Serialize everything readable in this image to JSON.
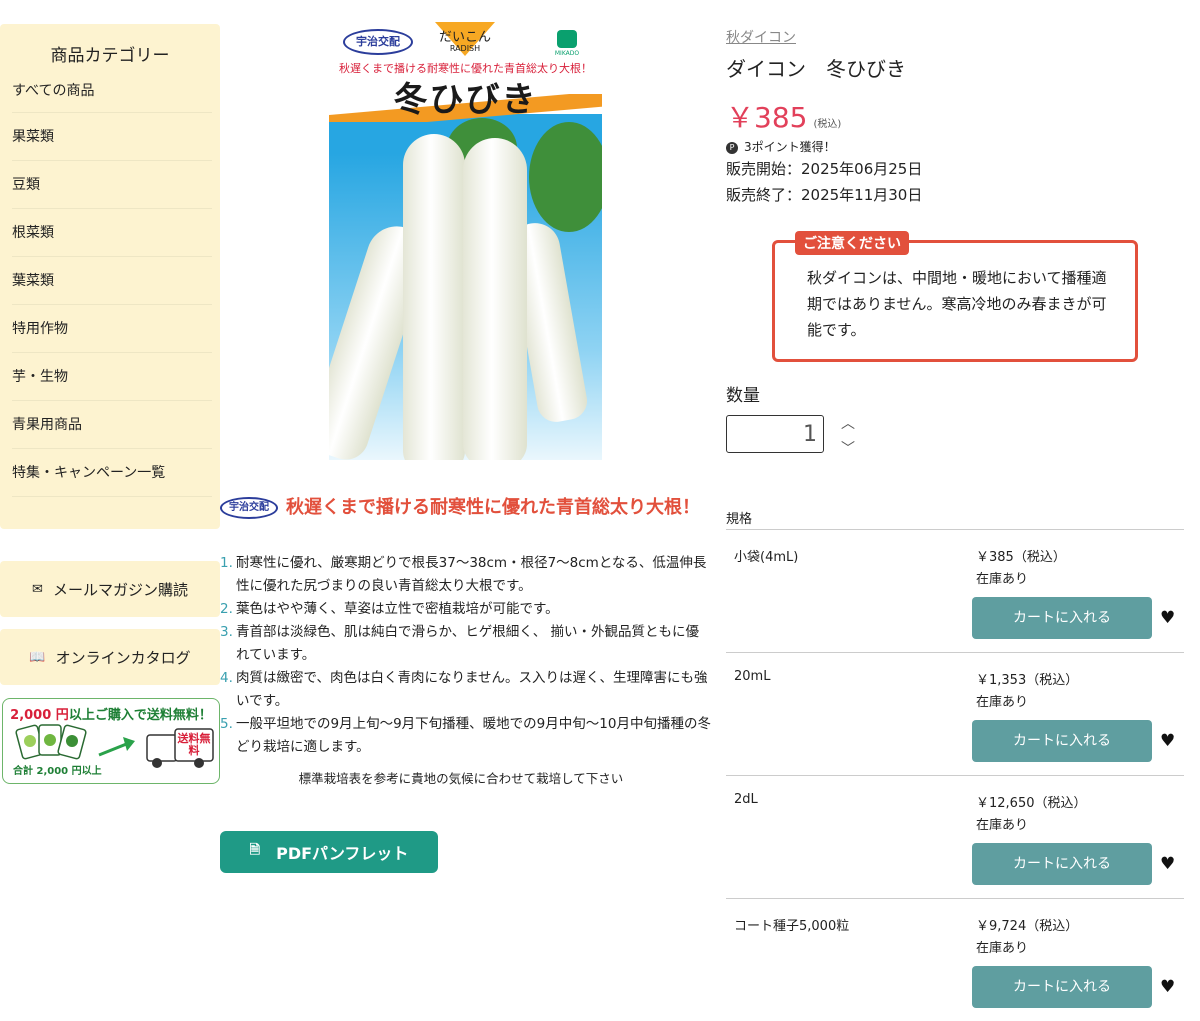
{
  "sidebar": {
    "title": "商品カテゴリー",
    "items": [
      "すべての商品",
      "果菜類",
      "豆類",
      "根菜類",
      "葉菜類",
      "特用作物",
      "芋・生物",
      "青果用商品",
      "特集・キャンペーン一覧"
    ],
    "mail_label": "メールマガジン購読",
    "catalog_label": "オンラインカタログ",
    "shipping": {
      "amount": "2,000 円",
      "text": "以上ご購入で送料無料！",
      "sub": "合計 2,000 円以上",
      "truck_label": "送料無料"
    }
  },
  "package": {
    "brand": "宇治交配",
    "category": "だいこん",
    "category_en": "RADISH",
    "maker": "MIKADO",
    "catch": "秋遅くまで播ける耐寒性に優れた青首総太り大根！",
    "name": "冬ひびき"
  },
  "description": {
    "brand": "宇治交配",
    "catch": "秋遅くまで播ける耐寒性に優れた青首総太り大根！",
    "points": [
      "耐寒性に優れ、厳寒期どりで根長37〜38cm・根径7〜8cmとなる、低温伸長性に優れた尻づまりの良い青首総太り大根です。",
      "葉色はやや薄く、草姿は立性で密植栽培が可能です。",
      "青首部は淡緑色、肌は純白で滑らか、ヒゲ根細く、 揃い・外観品質ともに優れています。",
      "肉質は緻密で、肉色は白く青肉になりません。ス入りは遅く、生理障害にも強いです。",
      "一般平坦地での9月上旬〜9月下旬播種、暖地での9月中旬〜10月中旬播種の冬どり栽培に適します。"
    ],
    "note": "標準栽培表を参考に貴地の気候に合わせて栽培して下さい",
    "pdf_label": "PDFパンフレット"
  },
  "product": {
    "breadcrumb": "秋ダイコン",
    "title": "ダイコン　冬ひびき",
    "price": "￥385",
    "tax": "(税込)",
    "points": "3ポイント獲得！",
    "sale_start": "販売開始：2025年06月25日",
    "sale_end": "販売終了：2025年11月30日",
    "notice_title": "ご注意ください",
    "notice_body": "秋ダイコンは、中間地・暖地において播種適期ではありません。寒高冷地のみ春まきが可能です。",
    "qty_label": "数量",
    "qty_value": "1",
    "spec_label": "規格",
    "variants": [
      {
        "name": "小袋(4mL)",
        "price": "￥385（税込）",
        "stock": "在庫あり",
        "cart": "カートに入れる"
      },
      {
        "name": "20mL",
        "price": "￥1,353（税込）",
        "stock": "在庫あり",
        "cart": "カートに入れる"
      },
      {
        "name": "2dL",
        "price": "￥12,650（税込）",
        "stock": "在庫あり",
        "cart": "カートに入れる"
      },
      {
        "name": "コート種子5,000粒",
        "price": "￥9,724（税込）",
        "stock": "在庫あり",
        "cart": "カートに入れる"
      }
    ]
  },
  "colors": {
    "accent_red": "#e2503c",
    "price_pink": "#e2405a",
    "cart_teal": "#5f9ea0",
    "pdf_green": "#1f9a86",
    "sidebar_bg": "#fdf3d0"
  }
}
